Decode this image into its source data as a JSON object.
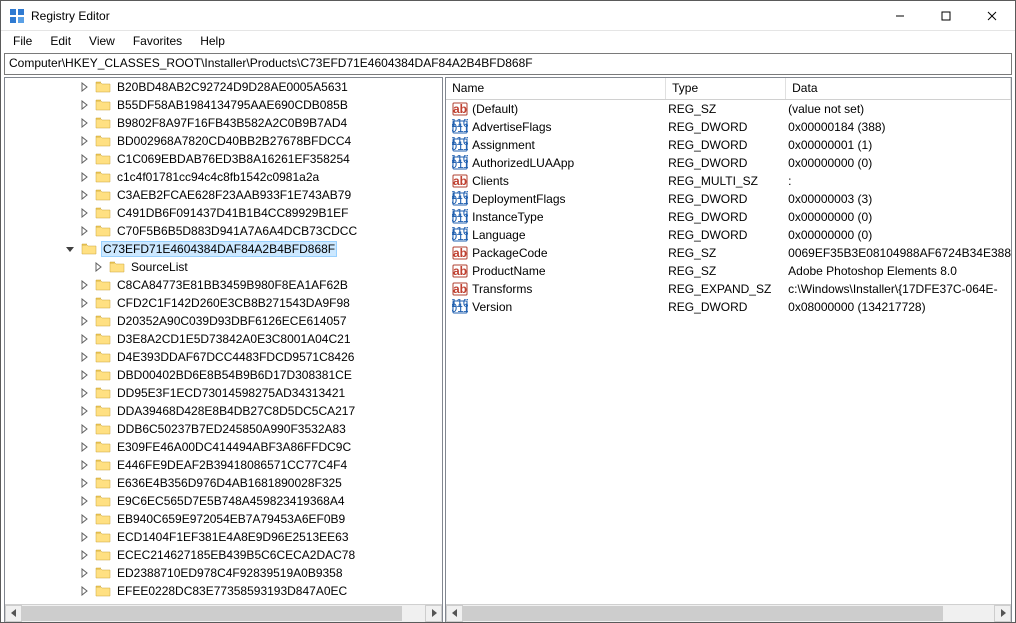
{
  "window": {
    "title": "Registry Editor"
  },
  "menu": {
    "file": "File",
    "edit": "Edit",
    "view": "View",
    "favorites": "Favorites",
    "help": "Help"
  },
  "address": "Computer\\HKEY_CLASSES_ROOT\\Installer\\Products\\C73EFD71E4604384DAF84A2B4BFD868F",
  "tree": {
    "items": [
      "B20BD48AB2C92724D9D28AE0005A5631",
      "B55DF58AB1984134795AAE690CDB085B",
      "B9802F8A97F16FB43B582A2C0B9B7AD4",
      "BD002968A7820CD40BB2B27678BFDCC4",
      "C1C069EBDAB76ED3B8A16261EF358254",
      "c1c4f01781cc94c4c8fb1542c0981a2a",
      "C3AEB2FCAE628F23AAB933F1E743AB79",
      "C491DB6F091437D41B1B4CC89929B1EF",
      "C70F5B6B5D883D941A7A6A4DCB73CDCC"
    ],
    "selected": "C73EFD71E4604384DAF84A2B4BFD868F",
    "child": "SourceList",
    "items_after": [
      "C8CA84773E81BB3459B980F8EA1AF62B",
      "CFD2C1F142D260E3CB8B271543DA9F98",
      "D20352A90C039D93DBF6126ECE614057",
      "D3E8A2CD1E5D73842A0E3C8001A04C21",
      "D4E393DDAF67DCC4483FDCD9571C8426",
      "DBD00402BD6E8B54B9B6D17D308381CE",
      "DD95E3F1ECD73014598275AD34313421",
      "DDA39468D428E8B4DB27C8D5DC5CA217",
      "DDB6C50237B7ED245850A990F3532A83",
      "E309FE46A00DC414494ABF3A86FFDC9C",
      "E446FE9DEAF2B39418086571CC77C4F4",
      "E636E4B356D976D4AB1681890028F325",
      "E9C6EC565D7E5B748A459823419368A4",
      "EB940C659E972054EB7A79453A6EF0B9",
      "ECD1404F1EF381E4A8E9D96E2513EE63",
      "ECEC214627185EB439B5C6CECA2DAC78",
      "ED2388710ED978C4F92839519A0B9358",
      "EFEE0228DC83E77358593193D847A0EC"
    ]
  },
  "columns": {
    "name": "Name",
    "type": "Type",
    "data": "Data"
  },
  "values": [
    {
      "icon": "string",
      "name": "(Default)",
      "type": "REG_SZ",
      "data": "(value not set)"
    },
    {
      "icon": "binary",
      "name": "AdvertiseFlags",
      "type": "REG_DWORD",
      "data": "0x00000184 (388)"
    },
    {
      "icon": "binary",
      "name": "Assignment",
      "type": "REG_DWORD",
      "data": "0x00000001 (1)"
    },
    {
      "icon": "binary",
      "name": "AuthorizedLUAApp",
      "type": "REG_DWORD",
      "data": "0x00000000 (0)"
    },
    {
      "icon": "string",
      "name": "Clients",
      "type": "REG_MULTI_SZ",
      "data": ":"
    },
    {
      "icon": "binary",
      "name": "DeploymentFlags",
      "type": "REG_DWORD",
      "data": "0x00000003 (3)"
    },
    {
      "icon": "binary",
      "name": "InstanceType",
      "type": "REG_DWORD",
      "data": "0x00000000 (0)"
    },
    {
      "icon": "binary",
      "name": "Language",
      "type": "REG_DWORD",
      "data": "0x00000000 (0)"
    },
    {
      "icon": "string",
      "name": "PackageCode",
      "type": "REG_SZ",
      "data": "0069EF35B3E08104988AF6724B34E388"
    },
    {
      "icon": "string",
      "name": "ProductName",
      "type": "REG_SZ",
      "data": "Adobe Photoshop Elements 8.0"
    },
    {
      "icon": "string",
      "name": "Transforms",
      "type": "REG_EXPAND_SZ",
      "data": "c:\\Windows\\Installer\\{17DFE37C-064E-"
    },
    {
      "icon": "binary",
      "name": "Version",
      "type": "REG_DWORD",
      "data": "0x08000000 (134217728)"
    }
  ]
}
